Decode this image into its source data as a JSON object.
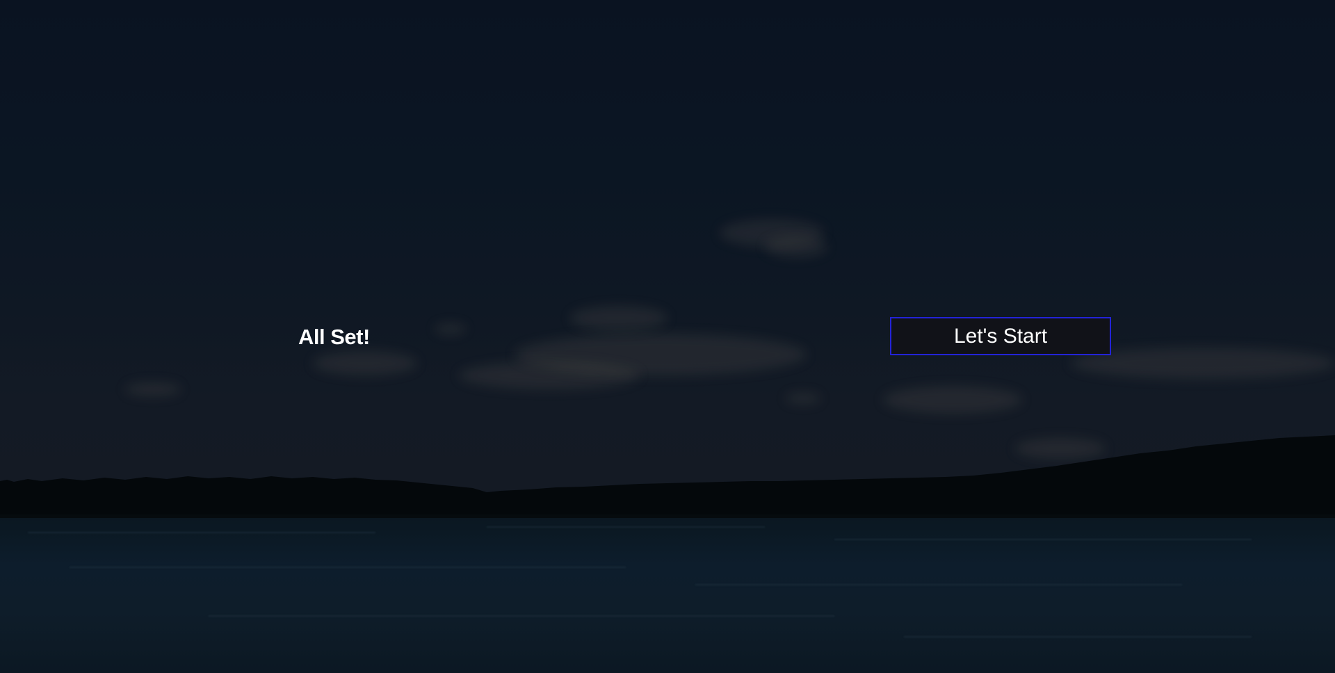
{
  "screen": {
    "heading": "All Set!",
    "start_button_label": "Let's Start"
  },
  "colors": {
    "button_border": "#2323d8",
    "button_background": "#111218",
    "text": "#ffffff"
  }
}
